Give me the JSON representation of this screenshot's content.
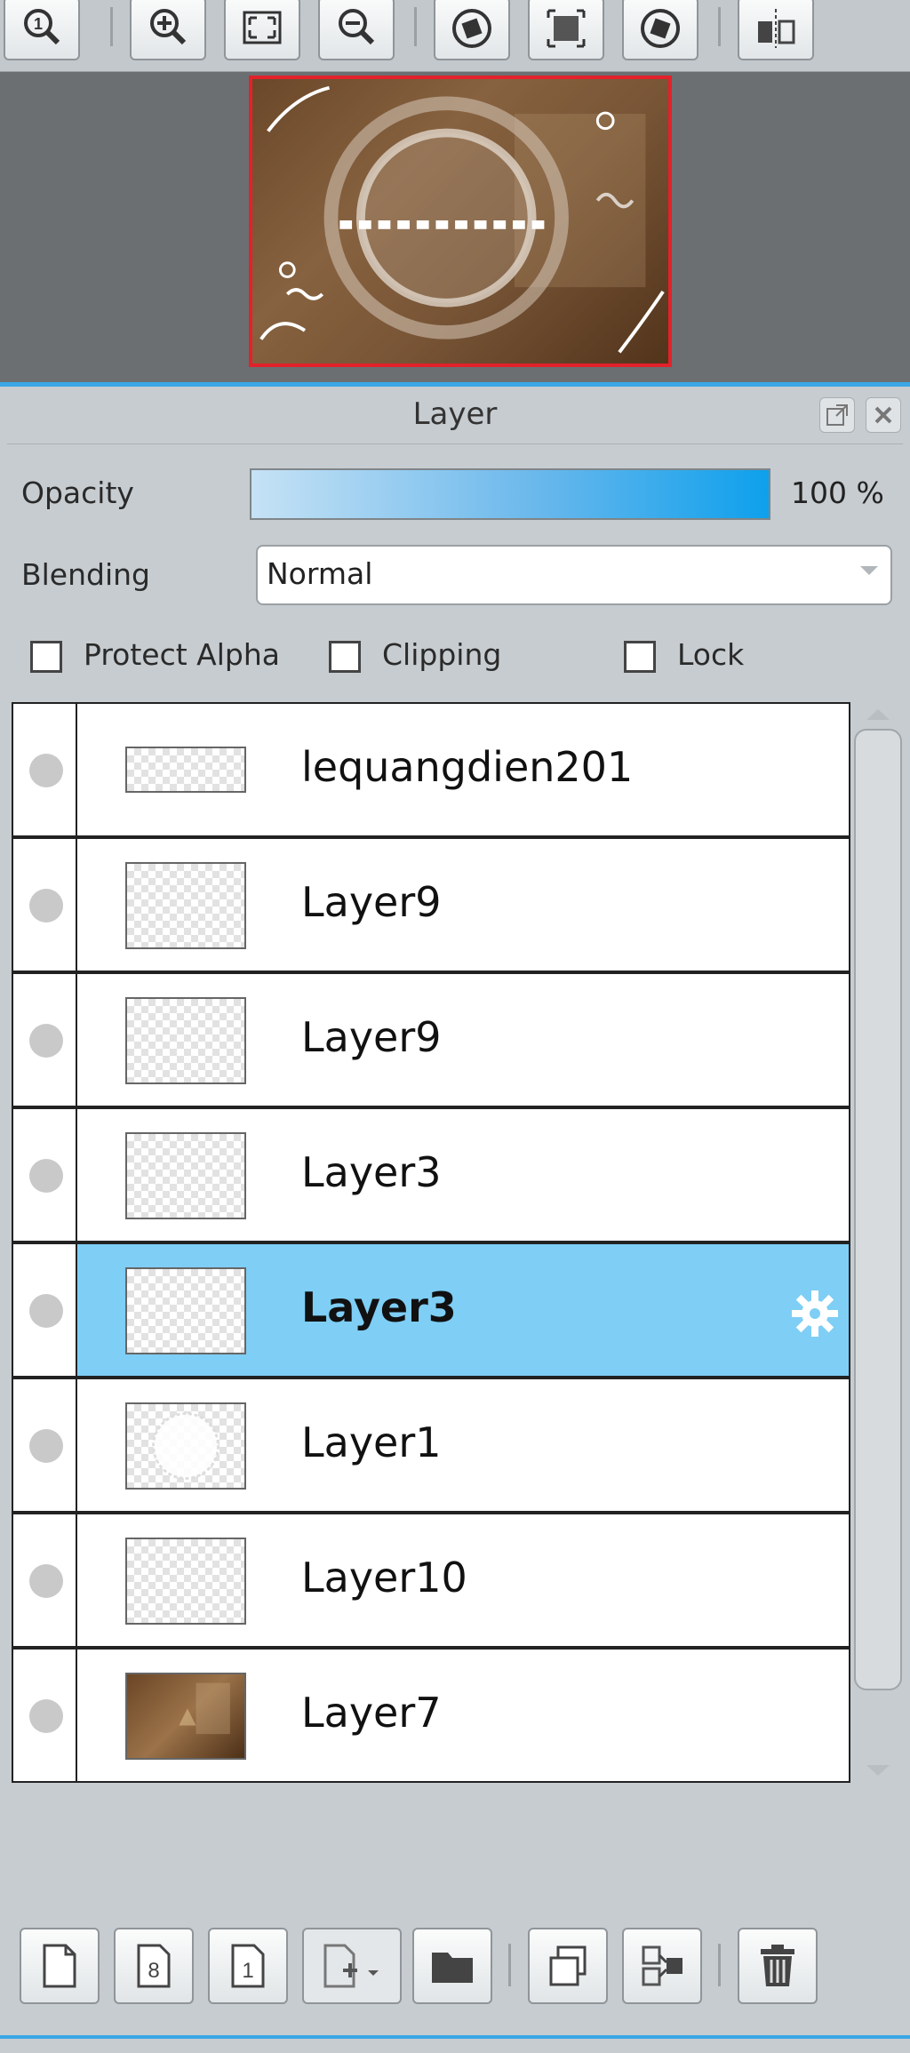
{
  "toolbar": {
    "buttons": [
      {
        "name": "zoom-actual-size",
        "icon": "magnifier-1-icon"
      },
      {
        "name": "zoom-in",
        "icon": "magnifier-plus-icon"
      },
      {
        "name": "fit-window",
        "icon": "fit-screen-icon"
      },
      {
        "name": "zoom-out",
        "icon": "magnifier-minus-icon"
      },
      {
        "name": "rotate-left",
        "icon": "rotate-left-icon"
      },
      {
        "name": "reset-view",
        "icon": "reset-view-icon"
      },
      {
        "name": "rotate-right",
        "icon": "rotate-right-icon"
      },
      {
        "name": "flip-horizontal",
        "icon": "flip-horizontal-icon"
      }
    ]
  },
  "layer_panel": {
    "title": "Layer",
    "opacity_label": "Opacity",
    "opacity_value": "100 %",
    "opacity_fraction": 1.0,
    "blending_label": "Blending",
    "blending_value": "Normal",
    "protect_alpha_label": "Protect Alpha",
    "clipping_label": "Clipping",
    "lock_label": "Lock",
    "protect_alpha_checked": false,
    "clipping_checked": false,
    "lock_checked": false,
    "layers": [
      {
        "name": "lequangdien201",
        "selected": false,
        "thumb": "transparent-wide"
      },
      {
        "name": "Layer9",
        "selected": false,
        "thumb": "transparent"
      },
      {
        "name": "Layer9",
        "selected": false,
        "thumb": "transparent"
      },
      {
        "name": "Layer3",
        "selected": false,
        "thumb": "transparent"
      },
      {
        "name": "Layer3",
        "selected": true,
        "thumb": "transparent"
      },
      {
        "name": "Layer1",
        "selected": false,
        "thumb": "circle"
      },
      {
        "name": "Layer10",
        "selected": false,
        "thumb": "transparent"
      },
      {
        "name": "Layer7",
        "selected": false,
        "thumb": "photo"
      }
    ],
    "bottom_buttons": [
      {
        "name": "new-layer",
        "icon": "new-page-icon"
      },
      {
        "name": "new-8bit-layer",
        "icon": "page-8-icon"
      },
      {
        "name": "new-1bit-layer",
        "icon": "page-1-icon"
      },
      {
        "name": "add-layer-menu",
        "icon": "page-plus-dropdown-icon"
      },
      {
        "name": "new-folder",
        "icon": "folder-icon"
      },
      {
        "name": "duplicate-layer",
        "icon": "duplicate-icon"
      },
      {
        "name": "merge-down",
        "icon": "merge-down-icon"
      },
      {
        "name": "delete-layer",
        "icon": "trash-icon"
      }
    ]
  },
  "colors": {
    "accent": "#3aa7e6",
    "selected_row": "#7ecef5",
    "preview_border": "#e3212a"
  }
}
